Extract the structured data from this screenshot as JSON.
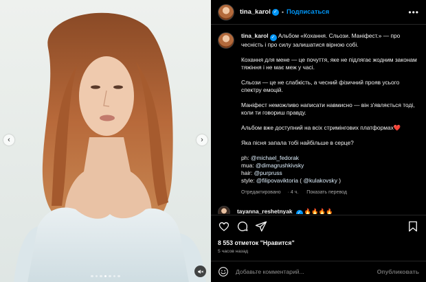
{
  "post": {
    "username": "tina_karol",
    "follow_label": "Подписаться",
    "separator": "•",
    "more_label": "•••"
  },
  "media": {
    "prev_label": "‹",
    "next_label": "›",
    "slide_count": 7,
    "active_slide": 4,
    "mute_icon": "speaker-muted-icon"
  },
  "caption": {
    "username": "tina_karol",
    "paragraphs": [
      "Альбом «Кохання. Сльози. Маніфест.» — про чесність і про силу залишатися вірною собі.",
      "Кохання для мене — це почуття, яке не підлягає жодним законам тяжіння і не має меж у часі.",
      "Сльози — це не слабкість, а чесний фізичний прояв усього спектру емоцій.",
      "Маніфест неможливо написати навмисно — він з'являється тоді, коли ти говориш правду."
    ],
    "album_line": "Альбом вже доступний на всіх стримінгових платформах",
    "heart": "❤️",
    "question": "Яка пісня запала тобі найбільше в серце?",
    "credits": {
      "ph_label": "ph: ",
      "ph": "@michael_fedorak",
      "mua_label": "mua: ",
      "mua": "@dimagrushkivsky",
      "hair_label": "hair: ",
      "hair": "@purpruss",
      "style_label": "style: ",
      "style1": "@filipovaviktoria",
      "style_open": " ( ",
      "style2": "@kulakovsky",
      "style_close": " )"
    },
    "edited_label": "Отредактировано",
    "age": "4 ч.",
    "translate_label": "Показать перевод"
  },
  "comment": {
    "username": "tayanna_reshetnyak",
    "text": "🔥🔥🔥🔥"
  },
  "actions": {
    "like_icon": "heart-icon",
    "comment_icon": "comment-icon",
    "share_icon": "share-icon",
    "save_icon": "bookmark-icon"
  },
  "likes": {
    "count": "8 553",
    "text": "отметок \"Нравится\""
  },
  "posted_ago": "5 часов назад",
  "add_comment": {
    "placeholder": "Добавьте комментарий...",
    "publish_label": "Опубликовать"
  },
  "colors": {
    "accent": "#0095f6",
    "background": "#000000",
    "mention": "#e0f1ff",
    "muted_text": "#a8a8a8"
  }
}
